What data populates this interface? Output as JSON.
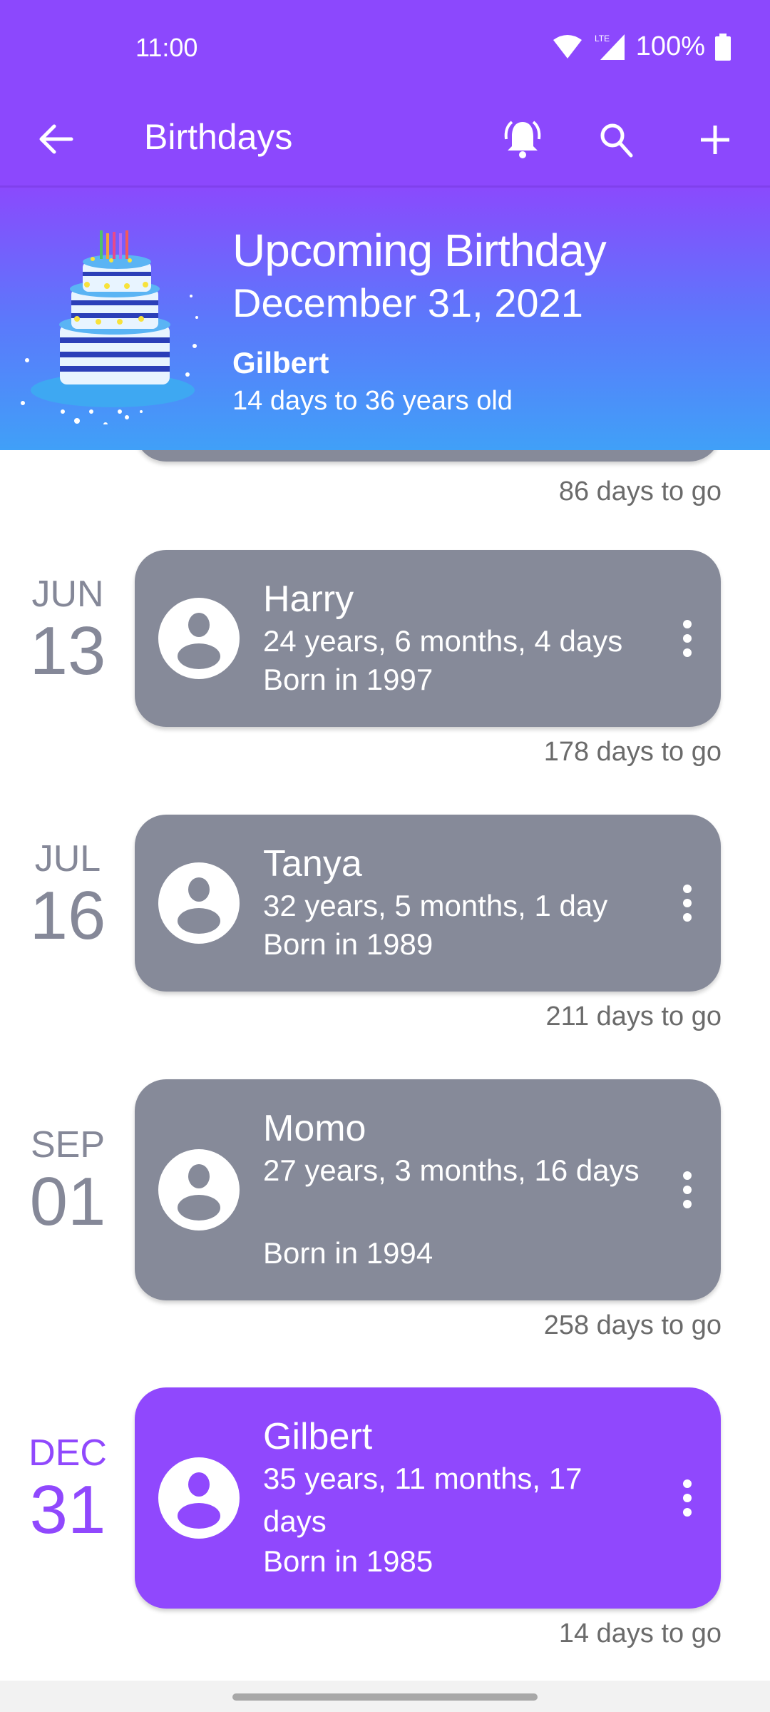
{
  "status_bar": {
    "time": "11:00",
    "battery": "100%",
    "network": "LTE"
  },
  "app_bar": {
    "title": "Birthdays",
    "icons": [
      "back-arrow-icon",
      "alarm-bell-icon",
      "search-icon",
      "add-icon"
    ]
  },
  "banner": {
    "title": "Upcoming Birthday",
    "date": "December 31, 2021",
    "name": "Gilbert",
    "subtitle": "14 days to 36 years old",
    "image": "birthday-cake-icon"
  },
  "list": {
    "partial_item": {
      "days_to_go": "86 days to go"
    },
    "items": [
      {
        "month": "JUN",
        "day": "13",
        "name": "Harry",
        "age": "24 years, 6 months, 4 days",
        "born": "Born in 1997",
        "days_to_go": "178 days to go",
        "highlight": false
      },
      {
        "month": "JUL",
        "day": "16",
        "name": "Tanya",
        "age": "32 years, 5 months, 1 day",
        "born": "Born in 1989",
        "days_to_go": "211 days to go",
        "highlight": false
      },
      {
        "month": "SEP",
        "day": "01",
        "name": "Momo",
        "age": "27 years, 3 months, 16 days",
        "born": "Born in 1994",
        "days_to_go": "258 days to go",
        "highlight": false
      },
      {
        "month": "DEC",
        "day": "31",
        "name": "Gilbert",
        "age": "35 years, 11 months, 17 days",
        "born": "Born in 1985",
        "days_to_go": "14 days to go",
        "highlight": true
      }
    ]
  },
  "colors": {
    "primary": "#8c48fd",
    "card_gray": "#868a99",
    "card_highlight": "#9048fd",
    "date_gray": "#858898"
  }
}
